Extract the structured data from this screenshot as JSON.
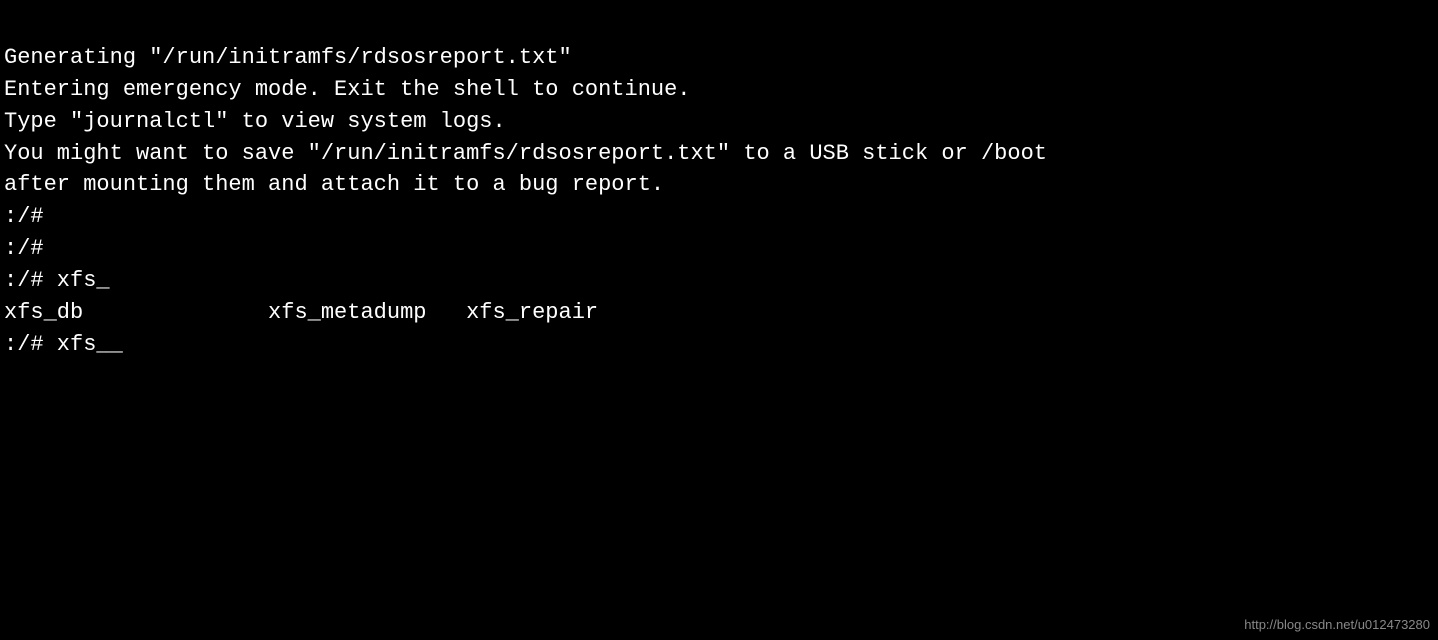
{
  "terminal": {
    "lines": [
      "Generating \"/run/initramfs/rdsosreport.txt\"",
      "",
      "",
      "Entering emergency mode. Exit the shell to continue.",
      "Type \"journalctl\" to view system logs.",
      "You might want to save \"/run/initramfs/rdsosreport.txt\" to a USB stick or /boot",
      "after mounting them and attach it to a bug report.",
      "",
      "",
      "",
      ":/# ",
      ":/# ",
      ":/# xfs_",
      "xfs_db              xfs_metadump   xfs_repair",
      ":/# xfs__"
    ]
  },
  "watermark": {
    "text": "http://blog.csdn.net/u012473280"
  }
}
